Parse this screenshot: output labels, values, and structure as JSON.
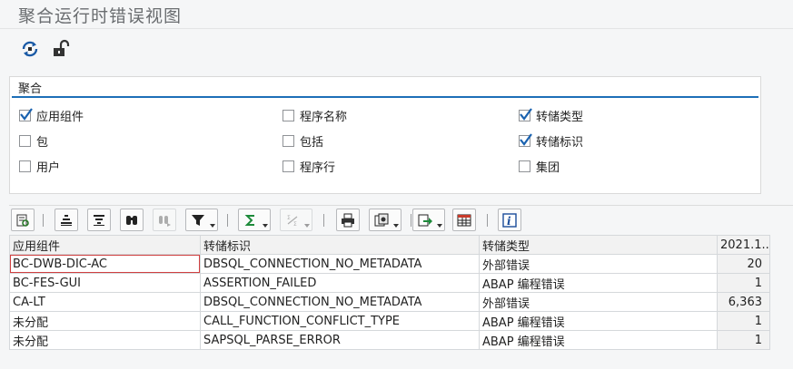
{
  "window": {
    "title": "聚合运行时错误视图"
  },
  "appbar": {
    "refresh_icon": "refresh-icon",
    "unlock_icon": "unlock-icon"
  },
  "aggregation": {
    "title": "聚合",
    "options": [
      {
        "label": "应用组件",
        "checked": true
      },
      {
        "label": "程序名称",
        "checked": false
      },
      {
        "label": "转储类型",
        "checked": true
      },
      {
        "label": "包",
        "checked": false
      },
      {
        "label": "包括",
        "checked": false
      },
      {
        "label": "转储标识",
        "checked": true
      },
      {
        "label": "用户",
        "checked": false
      },
      {
        "label": "程序行",
        "checked": false
      },
      {
        "label": "集团",
        "checked": false
      }
    ]
  },
  "toolbar": {
    "buttons": [
      "details-icon",
      "sort-ascending-icon",
      "sort-descending-icon",
      "find-icon",
      "find-next-icon",
      "filter-icon",
      "sum-icon",
      "subtotal-icon",
      "print-icon",
      "views-icon",
      "export-icon",
      "layout-icon",
      "info-icon"
    ]
  },
  "grid": {
    "columns": [
      "应用组件",
      "转储标识",
      "转储类型",
      "2021.1..."
    ],
    "rows": [
      [
        "BC-DWB-DIC-AC",
        "DBSQL_CONNECTION_NO_METADATA",
        "外部错误",
        "20"
      ],
      [
        "BC-FES-GUI",
        "ASSERTION_FAILED",
        "ABAP 编程错误",
        "1"
      ],
      [
        "CA-LT",
        "DBSQL_CONNECTION_NO_METADATA",
        "外部错误",
        "6,363"
      ],
      [
        "未分配",
        "CALL_FUNCTION_CONFLICT_TYPE",
        "ABAP 编程错误",
        "1"
      ],
      [
        "未分配",
        "SAPSQL_PARSE_ERROR",
        "ABAP 编程错误",
        "1"
      ]
    ]
  },
  "colors": {
    "accent": "#1d6fb8",
    "check": "#1a62b0"
  }
}
